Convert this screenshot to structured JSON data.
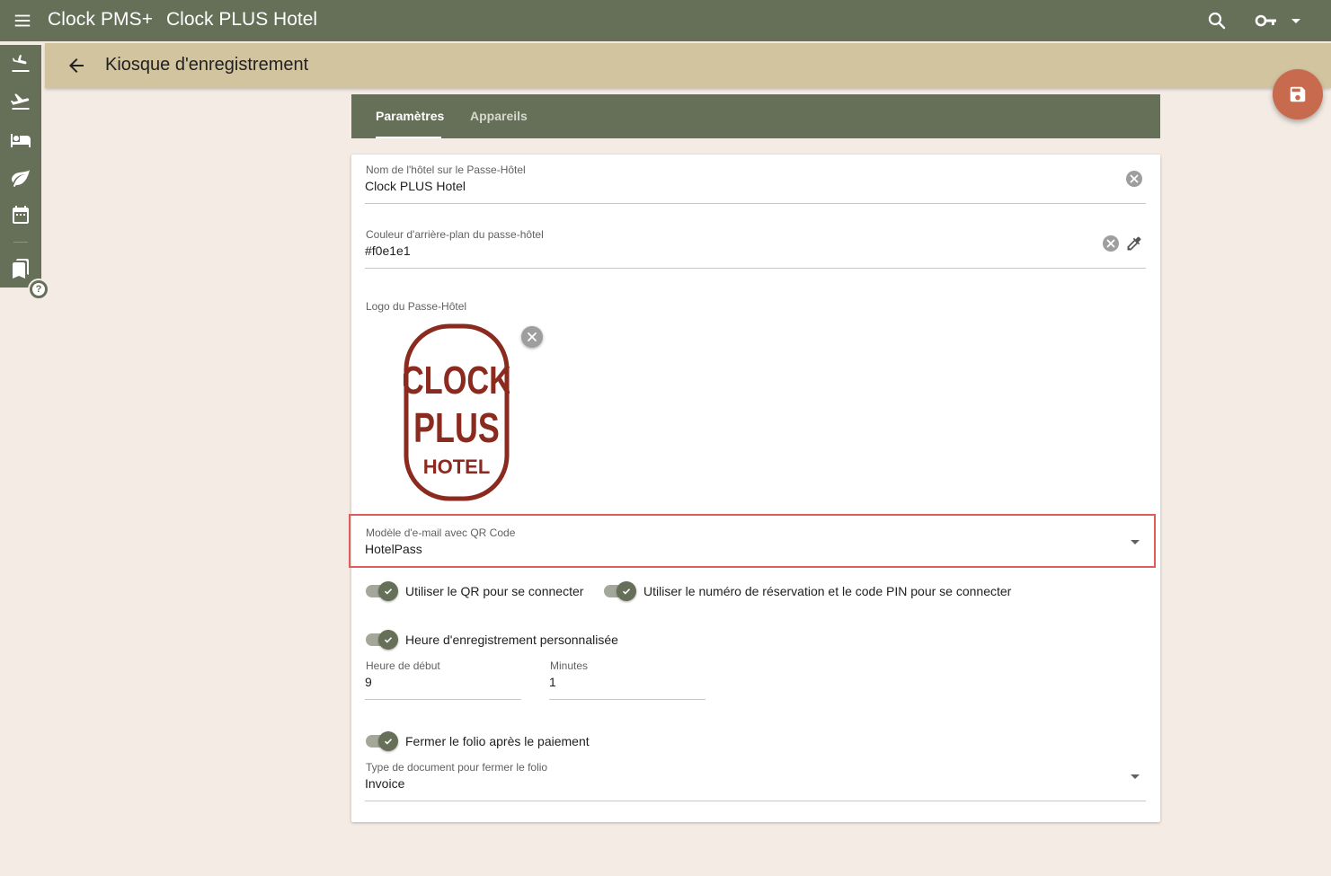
{
  "header": {
    "app_name": "Clock PMS+",
    "hotel_name": "Clock PLUS Hotel"
  },
  "subheader": {
    "title": "Kiosque d'enregistrement"
  },
  "tabs": [
    {
      "label": "Paramètres",
      "active": true
    },
    {
      "label": "Appareils",
      "active": false
    }
  ],
  "form": {
    "hotel_name_field": {
      "label": "Nom de l'hôtel sur le Passe-Hôtel",
      "value": "Clock PLUS Hotel"
    },
    "bg_color_field": {
      "label": "Couleur d'arrière-plan du passe-hôtel",
      "value": "#f0e1e1"
    },
    "logo": {
      "label": "Logo du Passe-Hôtel",
      "lines": [
        "CLOCK",
        "PLUS",
        "HOTEL"
      ]
    },
    "email_template": {
      "label": "Modèle d'e-mail avec QR Code",
      "value": "HotelPass"
    },
    "toggles": {
      "qr_login": {
        "label": "Utiliser le QR pour se connecter",
        "checked": true
      },
      "pin_login": {
        "label": "Utiliser le numéro de réservation et le code PIN pour se connecter",
        "checked": true
      },
      "custom_checkin": {
        "label": "Heure d'enregistrement personnalisée",
        "checked": true
      },
      "close_folio": {
        "label": "Fermer le folio après le paiement",
        "checked": true
      }
    },
    "start_hour": {
      "label": "Heure de début",
      "value": "9"
    },
    "minutes": {
      "label": "Minutes",
      "value": "1"
    },
    "doc_type": {
      "label": "Type de document pour fermer le folio",
      "value": "Invoice"
    }
  },
  "help_badge": "?",
  "colors": {
    "primary": "#666f58",
    "subheader": "#d3c4a0",
    "fab": "#c86a4e",
    "logo": "#8b2a1e",
    "highlight": "#e05d5d",
    "background": "#f4ece4"
  }
}
